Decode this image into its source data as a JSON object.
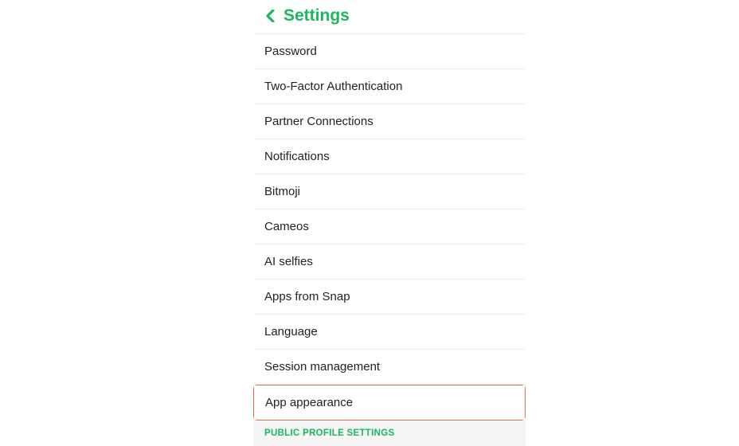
{
  "header": {
    "title": "Settings"
  },
  "settings": {
    "items": [
      {
        "label": "Password"
      },
      {
        "label": "Two-Factor Authentication"
      },
      {
        "label": "Partner Connections"
      },
      {
        "label": "Notifications"
      },
      {
        "label": "Bitmoji"
      },
      {
        "label": "Cameos"
      },
      {
        "label": "AI selfies"
      },
      {
        "label": "Apps from Snap"
      },
      {
        "label": "Language"
      },
      {
        "label": "Session management"
      },
      {
        "label": "App appearance"
      }
    ]
  },
  "section": {
    "public_profile": "PUBLIC PROFILE SETTINGS"
  }
}
